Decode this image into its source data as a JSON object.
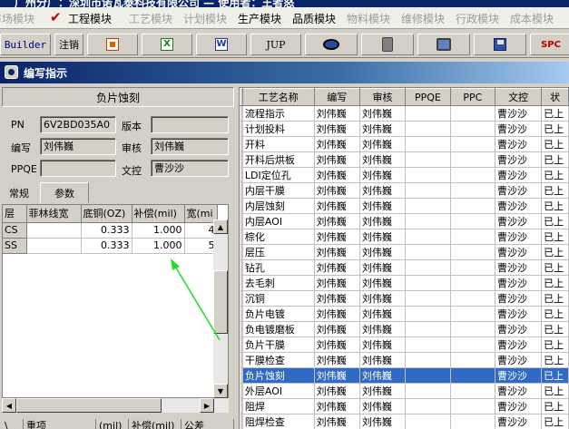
{
  "app": {
    "title": "广州分厂：深圳市诺瓦泰科技有限公司 — 使用者：王者怒"
  },
  "modules": [
    {
      "label": "市场模块",
      "enabled": false
    },
    {
      "label": "工程模块",
      "enabled": true,
      "checked": true
    },
    {
      "label": "工艺模块",
      "enabled": false
    },
    {
      "label": "计划模块",
      "enabled": false
    },
    {
      "label": "生产模块",
      "enabled": true
    },
    {
      "label": "品质模块",
      "enabled": true
    },
    {
      "label": "物料模块",
      "enabled": false
    },
    {
      "label": "维修模块",
      "enabled": false
    },
    {
      "label": "行政模块",
      "enabled": false
    },
    {
      "label": "成本模块",
      "enabled": false
    }
  ],
  "toolbar": {
    "builder": "Builder",
    "logout": "注销",
    "jup": "JUP",
    "spc": "SPC",
    "icons": [
      "powerpoint-icon",
      "excel-icon",
      "word-icon",
      "jup",
      "view-eye-icon",
      "database-icon",
      "network-icon",
      "save-disk-icon",
      "spc"
    ]
  },
  "window": {
    "title": "编写指示"
  },
  "left": {
    "header": "负片蚀刻",
    "fields": {
      "pn_label": "PN",
      "pn_value": "6V2BD035A0",
      "version_label": "版本",
      "version_value": "",
      "writer_label": "编写",
      "writer_value": "刘伟巍",
      "reviewer_label": "审核",
      "reviewer_value": "刘伟巍",
      "ppqe_label": "PPQE",
      "ppqe_value": "",
      "doc_label": "文控",
      "doc_value": "曹沙沙"
    },
    "tabs": [
      "常规",
      "参数"
    ],
    "active_tab": 1,
    "grid": {
      "headers": [
        "层",
        "菲林线宽",
        "底铜(OZ)",
        "补偿(mil)",
        "宽(mi"
      ],
      "rows": [
        [
          "CS",
          "",
          "0.333",
          "1.000",
          "4"
        ],
        [
          "SS",
          "",
          "0.333",
          "1.000",
          "5"
        ]
      ]
    },
    "bottom_headers": [
      "\\",
      "重项",
      "(mil)",
      "补偿(mil)",
      "公差"
    ]
  },
  "right": {
    "headers": [
      "工艺名称",
      "编写",
      "审核",
      "PPQE",
      "PPC",
      "文控",
      "状"
    ],
    "selected_row": 17,
    "rows": [
      [
        "流程指示",
        "刘伟巍",
        "刘伟巍",
        "",
        "",
        "曹沙沙",
        "已上"
      ],
      [
        "计划投料",
        "刘伟巍",
        "刘伟巍",
        "",
        "",
        "曹沙沙",
        "已上"
      ],
      [
        "开料",
        "刘伟巍",
        "刘伟巍",
        "",
        "",
        "曹沙沙",
        "已上"
      ],
      [
        "开料后烘板",
        "刘伟巍",
        "刘伟巍",
        "",
        "",
        "曹沙沙",
        "已上"
      ],
      [
        "LDI定位孔",
        "刘伟巍",
        "刘伟巍",
        "",
        "",
        "曹沙沙",
        "已上"
      ],
      [
        "内层干膜",
        "刘伟巍",
        "刘伟巍",
        "",
        "",
        "曹沙沙",
        "已上"
      ],
      [
        "内层蚀刻",
        "刘伟巍",
        "刘伟巍",
        "",
        "",
        "曹沙沙",
        "已上"
      ],
      [
        "内层AOI",
        "刘伟巍",
        "刘伟巍",
        "",
        "",
        "曹沙沙",
        "已上"
      ],
      [
        "棕化",
        "刘伟巍",
        "刘伟巍",
        "",
        "",
        "曹沙沙",
        "已上"
      ],
      [
        "层压",
        "刘伟巍",
        "刘伟巍",
        "",
        "",
        "曹沙沙",
        "已上"
      ],
      [
        "钻孔",
        "刘伟巍",
        "刘伟巍",
        "",
        "",
        "曹沙沙",
        "已上"
      ],
      [
        "去毛刺",
        "刘伟巍",
        "刘伟巍",
        "",
        "",
        "曹沙沙",
        "已上"
      ],
      [
        "沉铜",
        "刘伟巍",
        "刘伟巍",
        "",
        "",
        "曹沙沙",
        "已上"
      ],
      [
        "负片电镀",
        "刘伟巍",
        "刘伟巍",
        "",
        "",
        "曹沙沙",
        "已上"
      ],
      [
        "负电镀磨板",
        "刘伟巍",
        "刘伟巍",
        "",
        "",
        "曹沙沙",
        "已上"
      ],
      [
        "负片干膜",
        "刘伟巍",
        "刘伟巍",
        "",
        "",
        "曹沙沙",
        "已上"
      ],
      [
        "干膜检查",
        "刘伟巍",
        "刘伟巍",
        "",
        "",
        "曹沙沙",
        "已上"
      ],
      [
        "负片蚀刻",
        "刘伟巍",
        "刘伟巍",
        "",
        "",
        "曹沙沙",
        "已上"
      ],
      [
        "外层AOI",
        "刘伟巍",
        "刘伟巍",
        "",
        "",
        "曹沙沙",
        "已上"
      ],
      [
        "阻焊",
        "刘伟巍",
        "刘伟巍",
        "",
        "",
        "曹沙沙",
        "已上"
      ],
      [
        "阻焊检查",
        "刘伟巍",
        "刘伟巍",
        "",
        "",
        "曹沙沙",
        "已上"
      ]
    ]
  },
  "annotation": {
    "color": "#22dd22"
  }
}
